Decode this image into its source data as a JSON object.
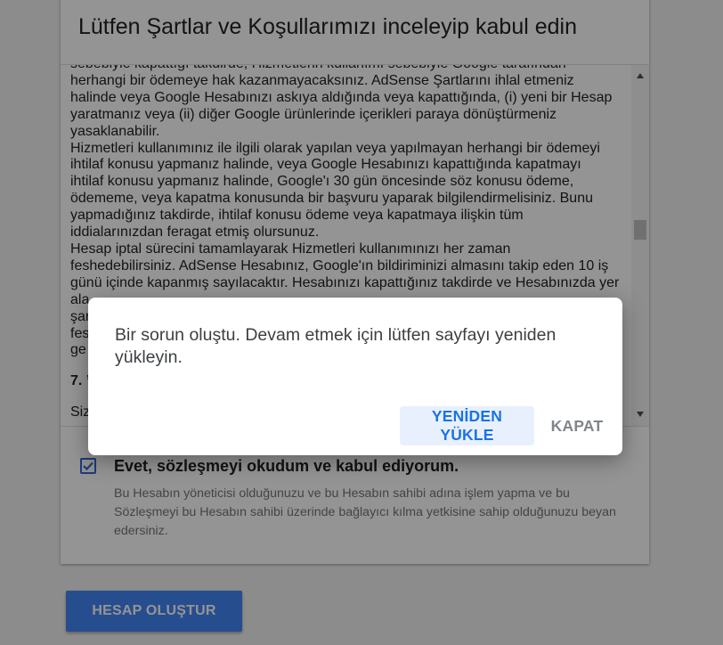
{
  "card": {
    "title": "Lütfen Şartlar ve Koşullarımızı inceleyip kabul edin"
  },
  "terms": {
    "lines_top": [
      "sebebiyle kapattığı takdirde, Hizmetlerin kullanımı sebebiyle Google tarafından",
      "herhangi bir ödemeye hak kazanmayacaksınız. AdSense Şartlarını ihlal etmeniz",
      "halinde veya Google Hesabınızı askıya aldığında veya kapattığında, (i) yeni bir Hesap",
      "yaratmanız veya (ii) diğer Google ürünlerinde içerikleri paraya dönüştürmeniz",
      "yasaklanabilir.",
      "Hizmetleri kullanımınız ile ilgili olarak yapılan veya yapılmayan herhangi bir ödemeyi",
      "ihtilaf konusu yapmanız halinde, veya Google Hesabınızı kapattığında kapatmayı",
      "ihtilaf konusu yapmanız halinde, Google'ı 30 gün öncesinde söz konusu ödeme,",
      "ödememe, veya kapatma konusunda bir başvuru yaparak bilgilendirmelisiniz. Bunu",
      "yapmadığınız takdirde, ihtilaf konusu ödeme veya kapatmaya ilişkin tüm",
      "iddialarınızdan feragat etmiş olursunuz.",
      "Hesap iptal sürecini tamamlayarak Hizmetleri kullanımınızı her zaman",
      "feshedebilirsiniz. AdSense Hesabınız, Google'ın bildiriminizi almasını takip eden 10 iş",
      "günü içinde kapanmış sayılacaktır. Hesabınızı kapattığınız takdirde ve Hesabınızda yer",
      "ala",
      "şar",
      "fes",
      "ge"
    ],
    "heading": "7. ’",
    "after": "Siz"
  },
  "agreement": {
    "label": "Evet, sözleşmeyi okudum ve kabul ediyorum.",
    "description": "Bu Hesabın yöneticisi olduğunuzu ve bu Hesabın sahibi adına işlem yapma ve bu Sözleşmeyi bu Hesabın sahibi üzerinde bağlayıcı kılma yetkisine sahip olduğunuzu beyan edersiniz.",
    "checked": true
  },
  "create_button": "HESAP OLUŞTUR",
  "dialog": {
    "message": "Bir sorun oluştu. Devam etmek için lütfen sayfayı yeniden yükleyin.",
    "reload_label": "YENİDEN YÜKLE",
    "close_label": "KAPAT"
  },
  "colors": {
    "accent": "#4285f4",
    "dialog_button_text": "#1a73e8",
    "dialog_button_bg": "#e8f0fe",
    "checkbox": "#3367d6"
  },
  "icons": {
    "scroll_up": "triangle-up-icon",
    "scroll_down": "triangle-down-icon",
    "checkbox": "checkmark-icon"
  }
}
